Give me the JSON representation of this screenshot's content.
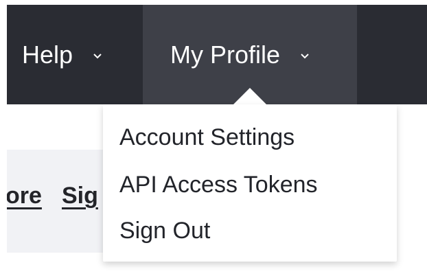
{
  "nav": {
    "help_label": "Help",
    "profile_label": "My Profile",
    "bar_color": "#2a2c33",
    "active_color": "#3e4048"
  },
  "content": {
    "link_1": "ore",
    "link_2": "Sig"
  },
  "profile_menu": {
    "items": [
      {
        "label": "Account Settings"
      },
      {
        "label": "API Access Tokens"
      },
      {
        "label": "Sign Out"
      }
    ]
  }
}
